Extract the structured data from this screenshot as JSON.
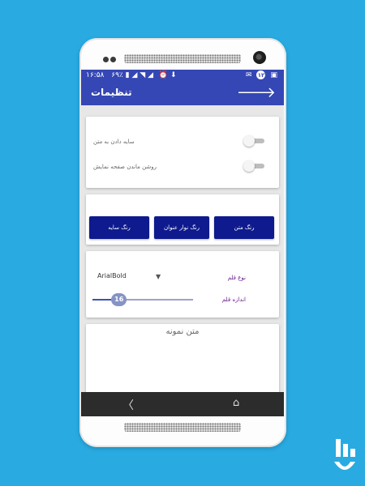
{
  "status_bar": {
    "time": "۱۶:۵۸",
    "battery": "۶۹٪",
    "notification_count": "۱۲"
  },
  "app_bar": {
    "title": "تنظیمات",
    "back_icon": "arrow-back-icon"
  },
  "settings": {
    "shadow_label": "سایه دادن به متن",
    "shadow_enabled": false,
    "screen_on_label": "روشن ماندن صفحه نمایش",
    "screen_on_enabled": false
  },
  "color_buttons": {
    "shadow_color": "رنگ سایه",
    "title_bar_color": "رنگ نوار عنوان",
    "text_color": "رنگ متن"
  },
  "font": {
    "type_label": "نوع قلم",
    "type_value": "ArialBold",
    "size_label": "اندازه قلم",
    "size_value": "16",
    "size_fraction": 0.26
  },
  "sample": {
    "text": "متن نمونه"
  },
  "nav": {
    "back_icon": "back-triangle-icon",
    "home_icon": "home-icon"
  },
  "colors": {
    "primary": "#3547b4",
    "button": "#0e1a8d",
    "background": "#29abe2"
  }
}
